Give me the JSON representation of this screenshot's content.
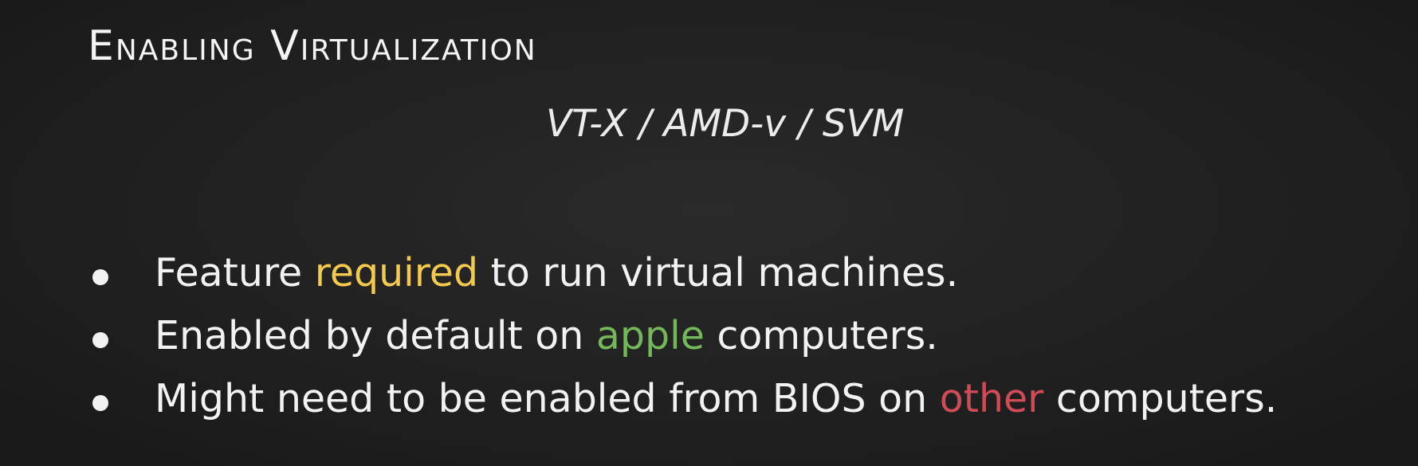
{
  "slide": {
    "title": "Enabling Virtualization",
    "subtitle": "VT-X / AMD-v / SVM",
    "bullets": [
      {
        "before": "Feature ",
        "highlight": "required",
        "after": " to run virtual machines.",
        "highlight_color": "#f3c94e"
      },
      {
        "before": "Enabled by default on ",
        "highlight": "apple",
        "after": " computers.",
        "highlight_color": "#74b65a"
      },
      {
        "before": "Might need to be enabled from BIOS on ",
        "highlight": "other",
        "after": " computers.",
        "highlight_color": "#cf4b57"
      }
    ]
  },
  "colors": {
    "background": "#202020",
    "text": "#f2f2f2"
  }
}
